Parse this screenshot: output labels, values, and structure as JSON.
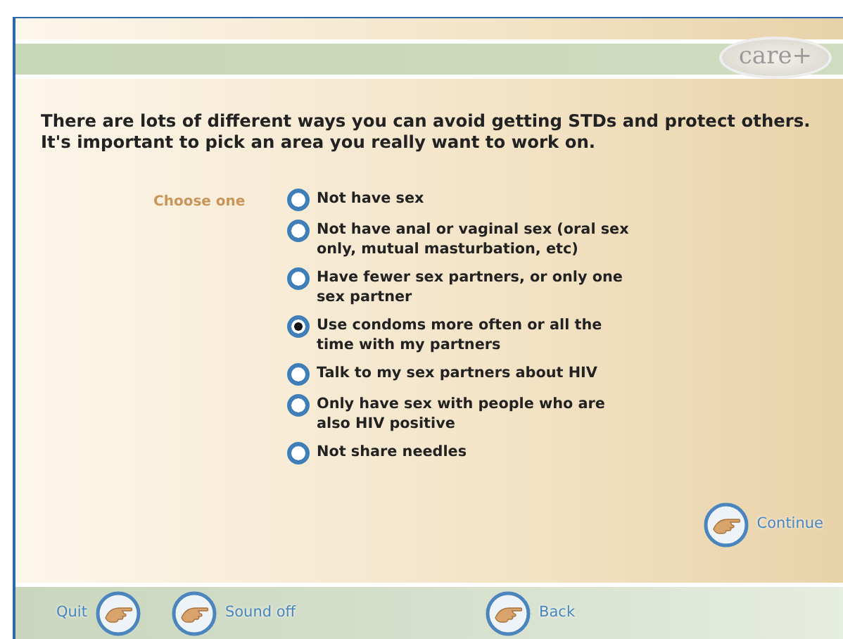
{
  "logo": {
    "text": "care+"
  },
  "intro": [
    "There are lots of different ways you can avoid getting STDs and protect others.",
    "It's important to pick an area you really want to work on."
  ],
  "prompt": "Choose one",
  "options": [
    {
      "label": "Not have sex",
      "selected": false
    },
    {
      "label": "Not have anal or vaginal sex (oral sex only, mutual masturbation, etc)",
      "selected": false
    },
    {
      "label": "Have fewer sex partners, or only one sex partner",
      "selected": false
    },
    {
      "label": "Use condoms more often or all the time with my partners",
      "selected": true
    },
    {
      "label": "Talk to my sex partners about HIV",
      "selected": false
    },
    {
      "label": "Only have sex with people who are also HIV positive",
      "selected": false
    },
    {
      "label": "Not share needles",
      "selected": false
    }
  ],
  "continue_button": {
    "label": "Continue"
  },
  "footer": [
    {
      "label": "Quit",
      "kind": "text-first"
    },
    {
      "label": "Sound off",
      "kind": "icon-first"
    },
    {
      "label": "Back",
      "kind": "icon-first"
    }
  ]
}
